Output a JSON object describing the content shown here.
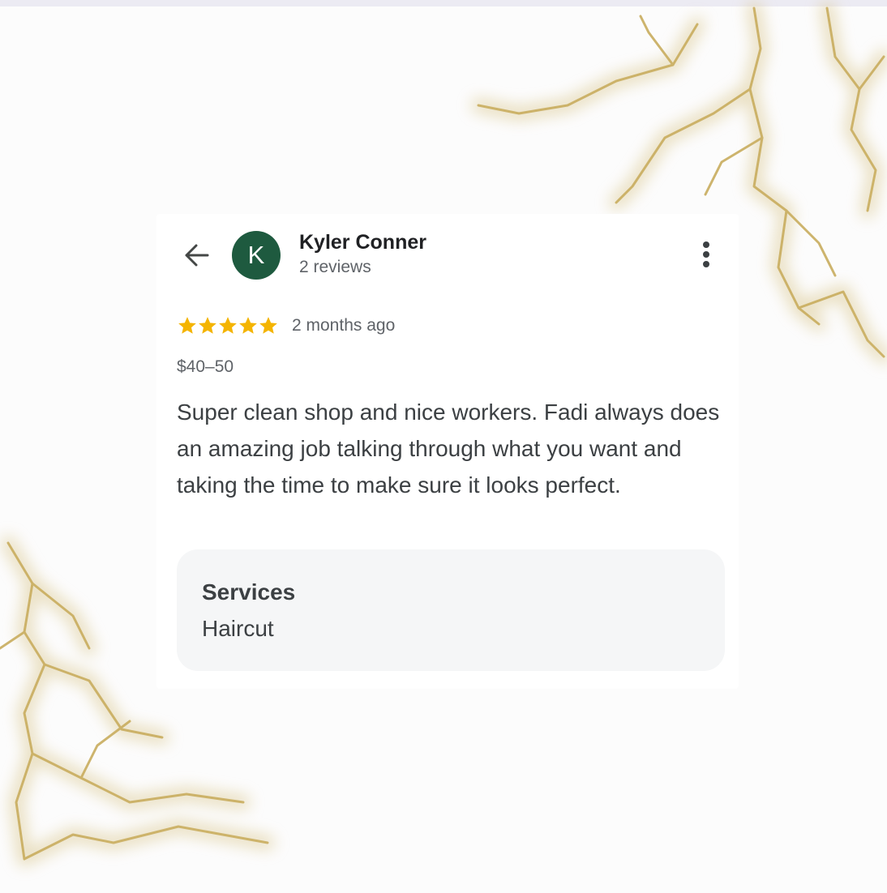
{
  "reviewer": {
    "initial": "K",
    "name": "Kyler Conner",
    "review_count": "2 reviews",
    "avatar_color": "#1e5a3f"
  },
  "header": {
    "back_icon": "arrow-left-icon",
    "menu_icon": "more-vertical-icon"
  },
  "review": {
    "rating": 5,
    "rating_max": 5,
    "star_color": "#f4b400",
    "date": "2 months ago",
    "price": "$40–50",
    "text": "Super clean shop and nice workers. Fadi always does an amazing job talking through what you want and taking the time to make sure it looks perfect."
  },
  "services": {
    "title": "Services",
    "value": "Haircut"
  }
}
